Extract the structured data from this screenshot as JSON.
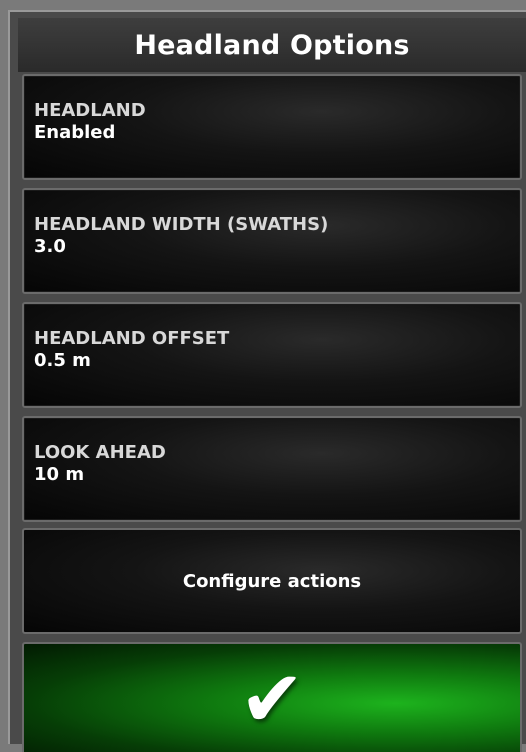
{
  "title": "Headland Options",
  "options": [
    {
      "label": "HEADLAND",
      "value": "Enabled"
    },
    {
      "label": "HEADLAND WIDTH (SWATHS)",
      "value": "3.0"
    },
    {
      "label": "HEADLAND OFFSET",
      "value": "0.5 m"
    },
    {
      "label": "LOOK AHEAD",
      "value": "10 m"
    }
  ],
  "configure_label": "Configure actions",
  "confirm_icon": "checkmark-icon",
  "colors": {
    "confirm_green": "#1db31d",
    "panel_bg": "#4a4a4a",
    "text": "#ffffff"
  }
}
